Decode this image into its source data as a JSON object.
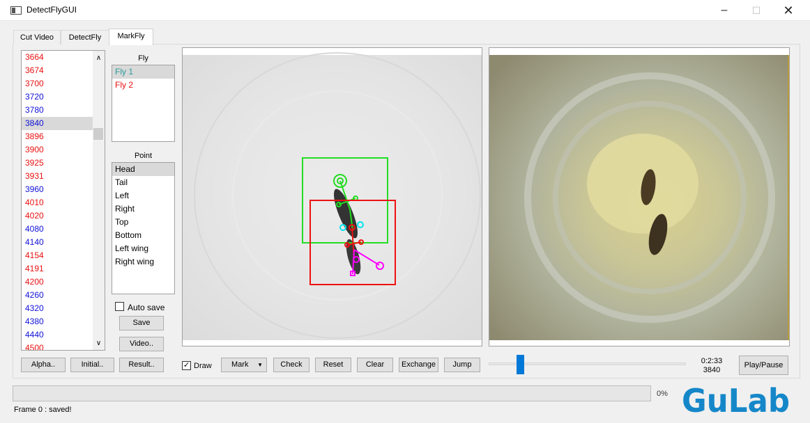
{
  "window": {
    "title": "DetectFlyGUI",
    "controls": [
      "–",
      "☐",
      "✕"
    ]
  },
  "tabs": [
    {
      "label": "Cut Video",
      "active": false
    },
    {
      "label": "DetectFly",
      "active": false
    },
    {
      "label": "MarkFly",
      "active": true
    }
  ],
  "frame_list": {
    "items": [
      {
        "label": "3664",
        "color": "#e81010",
        "selected": false
      },
      {
        "label": "3674",
        "color": "#e81010",
        "selected": false
      },
      {
        "label": "3700",
        "color": "#e81010",
        "selected": false
      },
      {
        "label": "3720",
        "color": "#1010d8",
        "selected": false
      },
      {
        "label": "3780",
        "color": "#1010d8",
        "selected": false
      },
      {
        "label": "3840",
        "color": "#1010d8",
        "selected": true
      },
      {
        "label": "3896",
        "color": "#e81010",
        "selected": false
      },
      {
        "label": "3900",
        "color": "#e81010",
        "selected": false
      },
      {
        "label": "3925",
        "color": "#e81010",
        "selected": false
      },
      {
        "label": "3931",
        "color": "#e81010",
        "selected": false
      },
      {
        "label": "3960",
        "color": "#1010d8",
        "selected": false
      },
      {
        "label": "4010",
        "color": "#e81010",
        "selected": false
      },
      {
        "label": "4020",
        "color": "#e81010",
        "selected": false
      },
      {
        "label": "4080",
        "color": "#1010d8",
        "selected": false
      },
      {
        "label": "4140",
        "color": "#1010d8",
        "selected": false
      },
      {
        "label": "4154",
        "color": "#e81010",
        "selected": false
      },
      {
        "label": "4191",
        "color": "#e81010",
        "selected": false
      },
      {
        "label": "4200",
        "color": "#e81010",
        "selected": false
      },
      {
        "label": "4260",
        "color": "#1010d8",
        "selected": false
      },
      {
        "label": "4320",
        "color": "#1010d8",
        "selected": false
      },
      {
        "label": "4380",
        "color": "#1010d8",
        "selected": false
      },
      {
        "label": "4440",
        "color": "#1010d8",
        "selected": false
      },
      {
        "label": "4500",
        "color": "#e81010",
        "selected": false
      }
    ]
  },
  "fly_panel": {
    "label": "Fly",
    "items": [
      {
        "label": "Fly 1",
        "color": "#2a9a9a",
        "selected": true
      },
      {
        "label": "Fly 2",
        "color": "#e81010",
        "selected": false
      }
    ]
  },
  "point_panel": {
    "label": "Point",
    "items": [
      {
        "label": "Head",
        "selected": true
      },
      {
        "label": "Tail",
        "selected": false
      },
      {
        "label": "Left",
        "selected": false
      },
      {
        "label": "Right",
        "selected": false
      },
      {
        "label": "Top",
        "selected": false
      },
      {
        "label": "Bottom",
        "selected": false
      },
      {
        "label": "Left wing",
        "selected": false
      },
      {
        "label": "Right wing",
        "selected": false
      }
    ]
  },
  "autosave": {
    "label": "Auto save",
    "checked": false
  },
  "buttons": {
    "save": "Save",
    "video": "Video..",
    "alpha": "Alpha..",
    "initial": "Initial..",
    "result": "Result..",
    "mark": "Mark",
    "check": "Check",
    "reset": "Reset",
    "clear": "Clear",
    "exchange": "Exchange",
    "jump": "Jump",
    "play_pause": "Play/Pause"
  },
  "draw": {
    "label": "Draw",
    "checked": true
  },
  "playback": {
    "time": "0:2:33",
    "frame": "3840",
    "position": 0.14
  },
  "progress": {
    "percent_text": "0%",
    "value": 0
  },
  "status": "Frame 0 : saved!",
  "logo": "GuLab",
  "colors": {
    "fly1": "#22dd22",
    "fly2": "#ee1111",
    "logo": "#1587c9"
  }
}
